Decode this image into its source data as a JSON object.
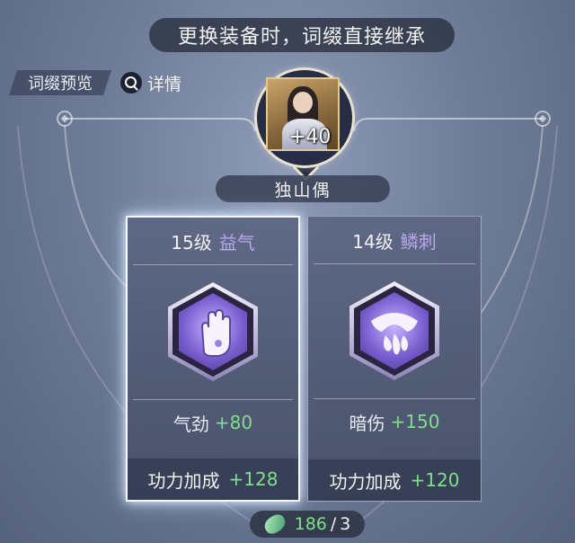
{
  "banner": "更换装备时，词缀直接继承",
  "preview_label": "词缀预览",
  "details_label": "详情",
  "character": {
    "level": "+40",
    "name": "独山偶",
    "icons": {
      "portrait": "character-portrait"
    }
  },
  "cards": [
    {
      "level": "15级",
      "affix": "益气",
      "icon": "palm-hand-icon",
      "stat_label": "气劲",
      "stat_value": "+80",
      "bonus_label": "功力加成",
      "bonus_value": "+128",
      "selected": true
    },
    {
      "level": "14级",
      "affix": "鳞刺",
      "icon": "claw-drops-icon",
      "stat_label": "暗伤",
      "stat_value": "+150",
      "bonus_label": "功力加成",
      "bonus_value": "+120",
      "selected": false
    }
  ],
  "cost": {
    "amount": "186",
    "separator": "/",
    "required": "3",
    "icon": "jade-stone-icon"
  },
  "colors": {
    "affix": "#b9a8f0",
    "positive": "#7ee08a",
    "selected_glow": "#dfe9ff"
  }
}
